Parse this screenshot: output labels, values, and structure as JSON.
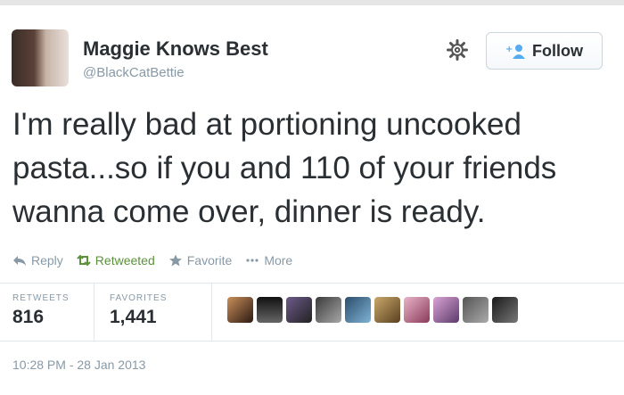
{
  "user": {
    "name": "Maggie Knows Best",
    "handle": "@BlackCatBettie"
  },
  "buttons": {
    "follow_label": "Follow"
  },
  "tweet": {
    "text": "I'm really bad at portioning uncooked pasta...so if you and 110 of your friends wanna come over, dinner is ready.",
    "timestamp": "10:28 PM - 28 Jan 2013"
  },
  "actions": {
    "reply": "Reply",
    "retweeted": "Retweeted",
    "favorite": "Favorite",
    "more": "More"
  },
  "stats": {
    "retweets_label": "RETWEETS",
    "retweets_value": "816",
    "favorites_label": "FAVORITES",
    "favorites_value": "1,441"
  },
  "icons": [
    "gear-icon",
    "add-user-icon",
    "reply-icon",
    "retweet-icon",
    "star-icon",
    "more-dots-icon"
  ],
  "colors": {
    "text": "#292f33",
    "muted": "#8899a6",
    "retweeted": "#5c913b",
    "border": "#e1e8ed"
  },
  "favoriters_count_shown": 10
}
